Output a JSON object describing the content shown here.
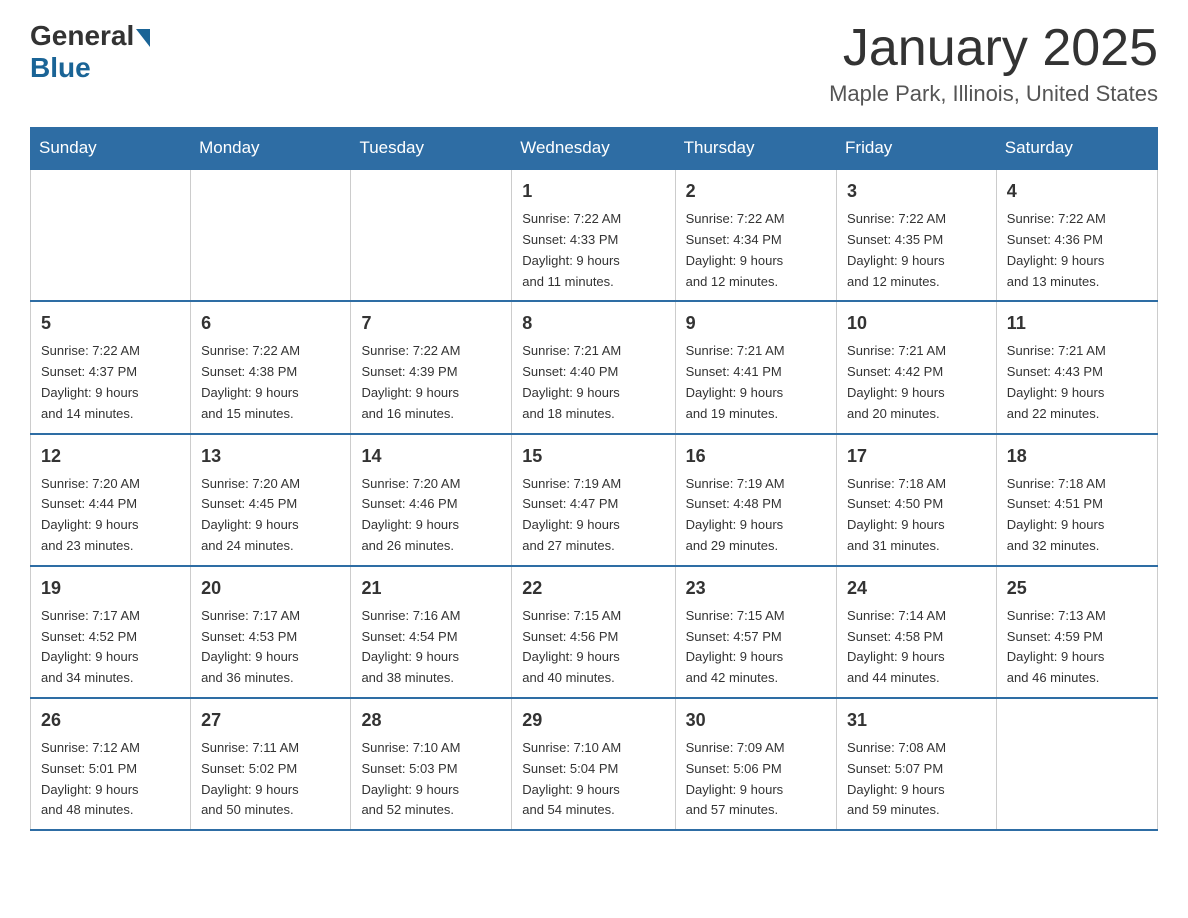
{
  "logo": {
    "general": "General",
    "blue": "Blue"
  },
  "title": "January 2025",
  "location": "Maple Park, Illinois, United States",
  "headers": [
    "Sunday",
    "Monday",
    "Tuesday",
    "Wednesday",
    "Thursday",
    "Friday",
    "Saturday"
  ],
  "weeks": [
    [
      {
        "day": "",
        "info": ""
      },
      {
        "day": "",
        "info": ""
      },
      {
        "day": "",
        "info": ""
      },
      {
        "day": "1",
        "info": "Sunrise: 7:22 AM\nSunset: 4:33 PM\nDaylight: 9 hours\nand 11 minutes."
      },
      {
        "day": "2",
        "info": "Sunrise: 7:22 AM\nSunset: 4:34 PM\nDaylight: 9 hours\nand 12 minutes."
      },
      {
        "day": "3",
        "info": "Sunrise: 7:22 AM\nSunset: 4:35 PM\nDaylight: 9 hours\nand 12 minutes."
      },
      {
        "day": "4",
        "info": "Sunrise: 7:22 AM\nSunset: 4:36 PM\nDaylight: 9 hours\nand 13 minutes."
      }
    ],
    [
      {
        "day": "5",
        "info": "Sunrise: 7:22 AM\nSunset: 4:37 PM\nDaylight: 9 hours\nand 14 minutes."
      },
      {
        "day": "6",
        "info": "Sunrise: 7:22 AM\nSunset: 4:38 PM\nDaylight: 9 hours\nand 15 minutes."
      },
      {
        "day": "7",
        "info": "Sunrise: 7:22 AM\nSunset: 4:39 PM\nDaylight: 9 hours\nand 16 minutes."
      },
      {
        "day": "8",
        "info": "Sunrise: 7:21 AM\nSunset: 4:40 PM\nDaylight: 9 hours\nand 18 minutes."
      },
      {
        "day": "9",
        "info": "Sunrise: 7:21 AM\nSunset: 4:41 PM\nDaylight: 9 hours\nand 19 minutes."
      },
      {
        "day": "10",
        "info": "Sunrise: 7:21 AM\nSunset: 4:42 PM\nDaylight: 9 hours\nand 20 minutes."
      },
      {
        "day": "11",
        "info": "Sunrise: 7:21 AM\nSunset: 4:43 PM\nDaylight: 9 hours\nand 22 minutes."
      }
    ],
    [
      {
        "day": "12",
        "info": "Sunrise: 7:20 AM\nSunset: 4:44 PM\nDaylight: 9 hours\nand 23 minutes."
      },
      {
        "day": "13",
        "info": "Sunrise: 7:20 AM\nSunset: 4:45 PM\nDaylight: 9 hours\nand 24 minutes."
      },
      {
        "day": "14",
        "info": "Sunrise: 7:20 AM\nSunset: 4:46 PM\nDaylight: 9 hours\nand 26 minutes."
      },
      {
        "day": "15",
        "info": "Sunrise: 7:19 AM\nSunset: 4:47 PM\nDaylight: 9 hours\nand 27 minutes."
      },
      {
        "day": "16",
        "info": "Sunrise: 7:19 AM\nSunset: 4:48 PM\nDaylight: 9 hours\nand 29 minutes."
      },
      {
        "day": "17",
        "info": "Sunrise: 7:18 AM\nSunset: 4:50 PM\nDaylight: 9 hours\nand 31 minutes."
      },
      {
        "day": "18",
        "info": "Sunrise: 7:18 AM\nSunset: 4:51 PM\nDaylight: 9 hours\nand 32 minutes."
      }
    ],
    [
      {
        "day": "19",
        "info": "Sunrise: 7:17 AM\nSunset: 4:52 PM\nDaylight: 9 hours\nand 34 minutes."
      },
      {
        "day": "20",
        "info": "Sunrise: 7:17 AM\nSunset: 4:53 PM\nDaylight: 9 hours\nand 36 minutes."
      },
      {
        "day": "21",
        "info": "Sunrise: 7:16 AM\nSunset: 4:54 PM\nDaylight: 9 hours\nand 38 minutes."
      },
      {
        "day": "22",
        "info": "Sunrise: 7:15 AM\nSunset: 4:56 PM\nDaylight: 9 hours\nand 40 minutes."
      },
      {
        "day": "23",
        "info": "Sunrise: 7:15 AM\nSunset: 4:57 PM\nDaylight: 9 hours\nand 42 minutes."
      },
      {
        "day": "24",
        "info": "Sunrise: 7:14 AM\nSunset: 4:58 PM\nDaylight: 9 hours\nand 44 minutes."
      },
      {
        "day": "25",
        "info": "Sunrise: 7:13 AM\nSunset: 4:59 PM\nDaylight: 9 hours\nand 46 minutes."
      }
    ],
    [
      {
        "day": "26",
        "info": "Sunrise: 7:12 AM\nSunset: 5:01 PM\nDaylight: 9 hours\nand 48 minutes."
      },
      {
        "day": "27",
        "info": "Sunrise: 7:11 AM\nSunset: 5:02 PM\nDaylight: 9 hours\nand 50 minutes."
      },
      {
        "day": "28",
        "info": "Sunrise: 7:10 AM\nSunset: 5:03 PM\nDaylight: 9 hours\nand 52 minutes."
      },
      {
        "day": "29",
        "info": "Sunrise: 7:10 AM\nSunset: 5:04 PM\nDaylight: 9 hours\nand 54 minutes."
      },
      {
        "day": "30",
        "info": "Sunrise: 7:09 AM\nSunset: 5:06 PM\nDaylight: 9 hours\nand 57 minutes."
      },
      {
        "day": "31",
        "info": "Sunrise: 7:08 AM\nSunset: 5:07 PM\nDaylight: 9 hours\nand 59 minutes."
      },
      {
        "day": "",
        "info": ""
      }
    ]
  ]
}
